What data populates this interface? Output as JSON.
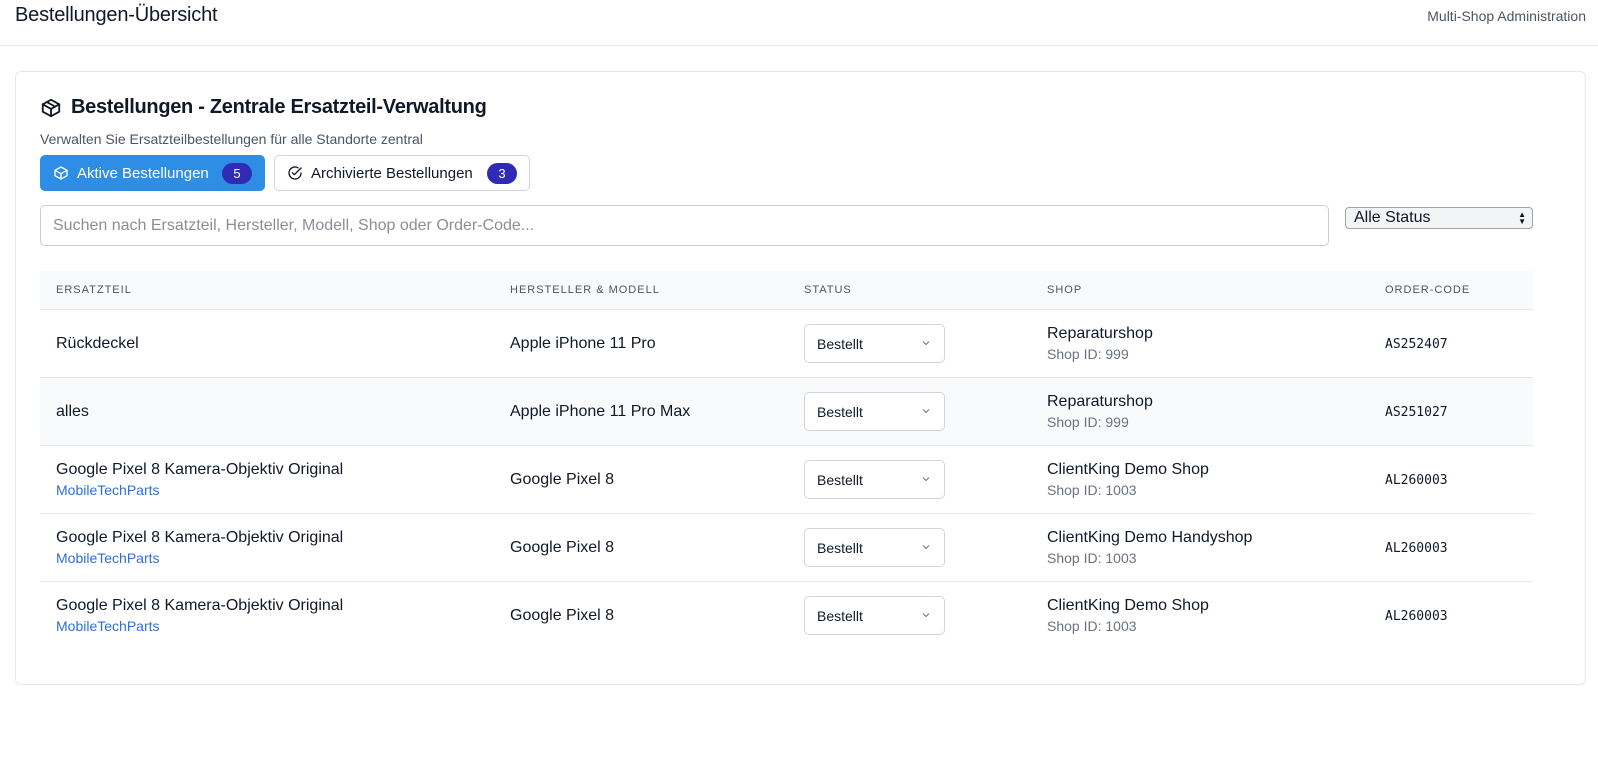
{
  "header": {
    "title": "Bestellungen-Übersicht",
    "subtitle": "Multi-Shop Administration"
  },
  "card": {
    "title": "Bestellungen - Zentrale Ersatzteil-Verwaltung",
    "description": "Verwalten Sie Ersatzteilbestellungen für alle Standorte zentral",
    "title_icon": "package-icon"
  },
  "tabs": [
    {
      "label": "Aktive Bestellungen",
      "count": "5",
      "icon": "package-icon",
      "active": true
    },
    {
      "label": "Archivierte Bestellungen",
      "count": "3",
      "icon": "check-circle-icon",
      "active": false
    }
  ],
  "search": {
    "placeholder": "Suchen nach Ersatzteil, Hersteller, Modell, Shop oder Order-Code...",
    "value": ""
  },
  "status_filter": {
    "selected": "Alle Status"
  },
  "table": {
    "columns": [
      "Ersatzteil",
      "Hersteller & Modell",
      "Status",
      "Shop",
      "Order-Code"
    ],
    "rows": [
      {
        "part": "Rückdeckel",
        "supplier": "",
        "model": "Apple iPhone 11 Pro",
        "status": "Bestellt",
        "shop": "Reparatursho p",
        "shop_id": "Shop ID: 999",
        "order_code": "AS252407"
      },
      {
        "part": "alles",
        "supplier": "",
        "model": "Apple iPhone 11 Pro Max",
        "status": "Bestellt",
        "shop": "Reparatursho p",
        "shop_id": "Shop ID: 999",
        "order_code": "AS251027"
      },
      {
        "part": "Google Pixel 8 Kamera-Objektiv Original",
        "supplier": "MobileTechParts",
        "model": "Google Pixel 8",
        "status": "Bestellt",
        "shop": "ClientKing Demo Shop",
        "shop_id": "Shop ID: 1003",
        "order_code": "AL260003"
      },
      {
        "part": "Google Pixel 8 Kamera-Objektiv Original",
        "supplier": "MobileTechParts",
        "model": "Google Pixel 8",
        "status": "Bestellt",
        "shop": "ClientKing Demo Handyshop",
        "shop_id": "Shop ID: 1003",
        "order_code": "AL260003"
      },
      {
        "part": "Google Pixel 8 Kamera-Objektiv Original",
        "supplier": "MobileTechParts",
        "model": "Google Pixel 8",
        "status": "Bestellt",
        "shop": "ClientKing Demo Shop",
        "shop_id": "Shop ID: 1003",
        "order_code": "AL260003"
      }
    ]
  },
  "colors": {
    "accent": "#2e8de4",
    "badge": "#2f2bb4",
    "link": "#2f6fd6"
  }
}
